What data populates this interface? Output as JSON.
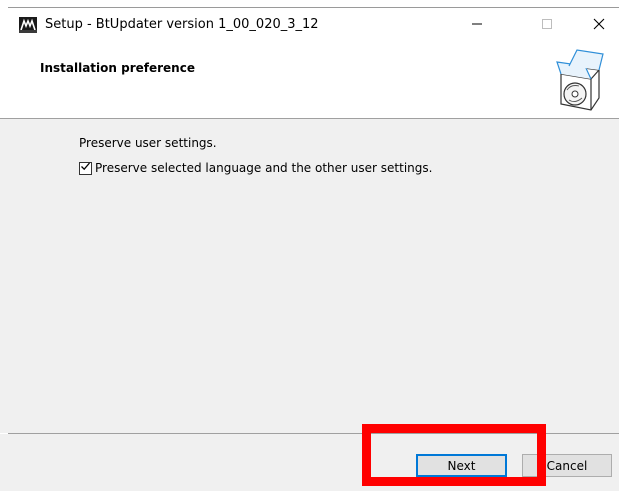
{
  "window": {
    "title": "Setup - BtUpdater version 1_00_020_3_12",
    "minimize_glyph": "—",
    "maximize_glyph": "☐",
    "close_glyph": "✕"
  },
  "header": {
    "title": "Installation preference",
    "icon": "setup-box-icon"
  },
  "content": {
    "description": "Preserve user settings.",
    "checkbox": {
      "label": "Preserve selected language and the other user settings.",
      "checked": true
    }
  },
  "buttons": {
    "next_label": "Next",
    "cancel_label": "Cancel"
  },
  "colors": {
    "highlight": "#ff0000",
    "focus": "#0078d7",
    "panel": "#f0f0f0"
  }
}
